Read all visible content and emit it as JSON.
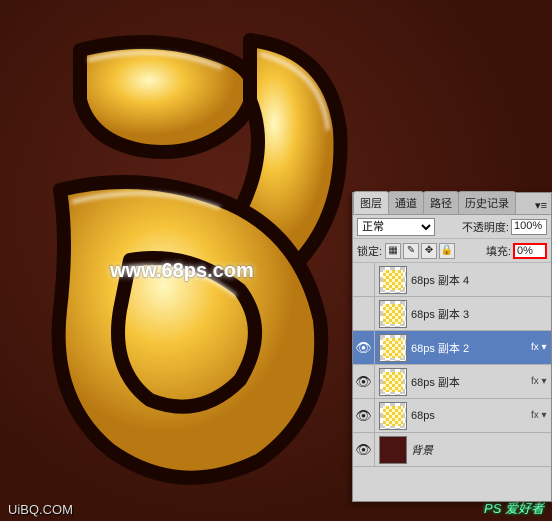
{
  "canvas": {
    "watermark": "www.68ps.com",
    "bottom_left": "UiBQ.COM",
    "bottom_right": "PS 爱好者"
  },
  "panel": {
    "tabs": {
      "layers": "图层",
      "channels": "通道",
      "paths": "路径",
      "history": "历史记录"
    },
    "blend_mode": "正常",
    "opacity_label": "不透明度:",
    "opacity_value": "100%",
    "lock_label": "锁定:",
    "fill_label": "填充:",
    "fill_value": "0%",
    "layers": [
      {
        "visible": false,
        "name": "68ps 副本 4",
        "fx": false,
        "selected": false
      },
      {
        "visible": false,
        "name": "68ps 副本 3",
        "fx": false,
        "selected": false
      },
      {
        "visible": true,
        "name": "68ps 副本 2",
        "fx": true,
        "selected": true
      },
      {
        "visible": true,
        "name": "68ps 副本",
        "fx": true,
        "selected": false
      },
      {
        "visible": true,
        "name": "68ps",
        "fx": true,
        "selected": false
      },
      {
        "visible": true,
        "name": "背景",
        "fx": false,
        "selected": false,
        "bg": true
      }
    ]
  }
}
